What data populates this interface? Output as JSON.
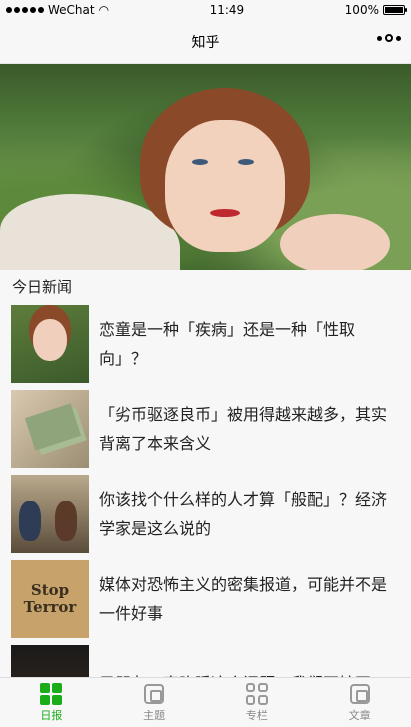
{
  "status_bar": {
    "carrier": "WeChat",
    "time": "11:49",
    "battery_text": "100%",
    "battery_level": 1.0
  },
  "nav": {
    "title": "知乎"
  },
  "hero": {
    "image": "girl-lying-in-grass-photo"
  },
  "section": {
    "title": "今日新闻"
  },
  "news": [
    {
      "title": "恋童是一种「疾病」还是一种「性取向」？",
      "thumb": "girl-portrait-photo"
    },
    {
      "title": "「劣币驱逐良币」被用得越来越多，其实背离了本来含义",
      "thumb": "money-bills-photo"
    },
    {
      "title": "你该找个什么样的人才算「般配」？经济学家是这么说的",
      "thumb": "couple-bookstore-photo"
    },
    {
      "title": "媒体对恐怖主义的密集报道，可能并不是一件好事",
      "thumb": "stop-terror-sign",
      "thumb_text_1": "Stop",
      "thumb_text_2": "Terror"
    },
    {
      "title": "男朋友一直晚睡这个问题，我们不妨开",
      "thumb": "dark-scene-photo"
    }
  ],
  "tabs": [
    {
      "label": "日报",
      "icon": "grid-icon",
      "active": true
    },
    {
      "label": "主题",
      "icon": "chip-icon",
      "active": false
    },
    {
      "label": "专栏",
      "icon": "squares-icon",
      "active": false
    },
    {
      "label": "文章",
      "icon": "chip-icon",
      "active": false
    }
  ],
  "colors": {
    "accent": "#1aad19",
    "bar_background": "#f7f7f7",
    "tab_inactive": "#888888"
  }
}
